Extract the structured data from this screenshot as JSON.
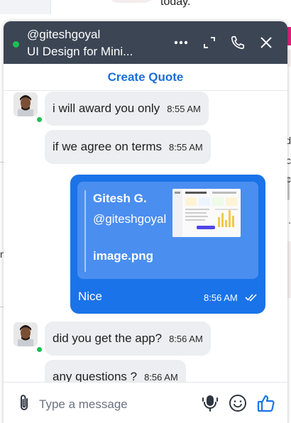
{
  "background": {
    "top_text": "today.",
    "right_letters": [
      "d",
      "c",
      "c",
      "."
    ],
    "left_letter": "n"
  },
  "header": {
    "username": "@giteshgoyal",
    "title": "UI Design for Mini...",
    "icons": [
      "more-icon",
      "expand-icon",
      "phone-icon",
      "close-icon"
    ],
    "status": "online"
  },
  "quote_bar": {
    "label": "Create Quote"
  },
  "messages": [
    {
      "direction": "in",
      "text": "i will award you only",
      "time": "8:55 AM"
    },
    {
      "direction": "in",
      "text": "if we agree on terms",
      "time": "8:55 AM"
    },
    {
      "direction": "out",
      "quoted": {
        "name": "Gitesh G.",
        "handle": "@giteshgoyal",
        "attachment": "image.png"
      },
      "text": "Nice",
      "time": "8:56 AM",
      "read": true
    },
    {
      "direction": "in",
      "text": "did you get the app?",
      "time": "8:56 AM"
    },
    {
      "direction": "in",
      "text": "any questions ?",
      "time": "8:56 AM"
    }
  ],
  "composer": {
    "placeholder": "Type a message",
    "icons": [
      "attachment-icon",
      "microphone-icon",
      "emoji-icon",
      "thumbs-up-icon"
    ]
  },
  "colors": {
    "header_bg": "#3c4554",
    "accent": "#1a73e8",
    "incoming_bubble": "#eceef1",
    "online": "#1dbf53",
    "link": "#1a6fdc"
  }
}
